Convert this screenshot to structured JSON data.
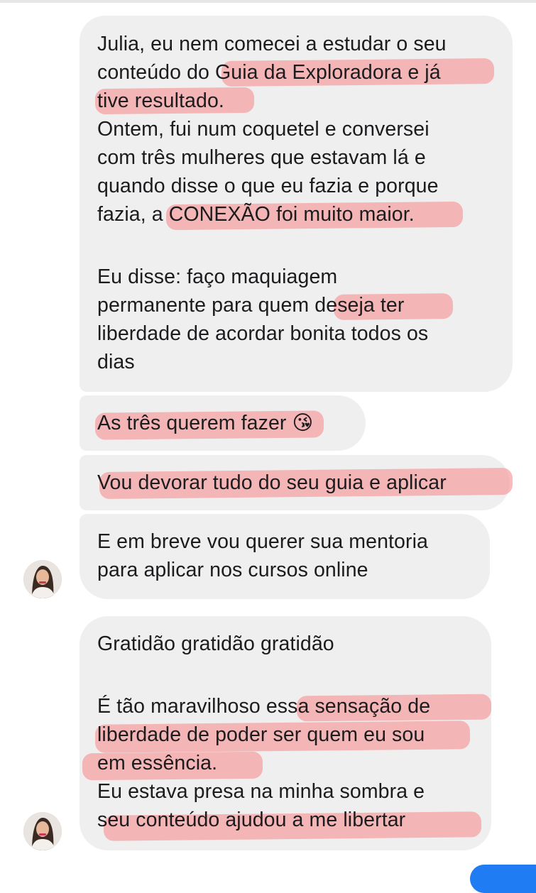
{
  "messages": [
    {
      "lines": [
        "Julia, eu nem comecei a estudar o seu",
        "conteúdo do Guia da Exploradora e já",
        "tive resultado.",
        "Ontem, fui num coquetel e conversei",
        "com três mulheres que estavam lá e",
        "quando disse o que eu fazia e porque",
        "fazia, a CONEXÃO foi muito maior."
      ],
      "lines2": [
        "Eu disse: faço maquiagem",
        "permanente para quem deseja ter",
        "liberdade de acordar bonita todos os",
        "dias"
      ]
    },
    {
      "text": "As três querem fazer",
      "emoji": "😘"
    },
    {
      "text": "Vou devorar tudo do seu guia e aplicar"
    },
    {
      "lines": [
        "E em breve vou querer sua mentoria",
        "para aplicar nos cursos online"
      ]
    },
    {
      "lines": [
        "Gratidão gratidão gratidão"
      ],
      "lines2": [
        "É tão maravilhoso essa sensação de",
        "liberdade de poder ser quem eu sou",
        "em essência.",
        "Eu estava presa na minha sombra e",
        "seu conteúdo ajudou a me libertar"
      ]
    }
  ],
  "highlight_color": "#f69292",
  "bubble_color": "#efeff0",
  "accent_color": "#1f7cf2",
  "sender_avatar": "profile-photo-woman"
}
